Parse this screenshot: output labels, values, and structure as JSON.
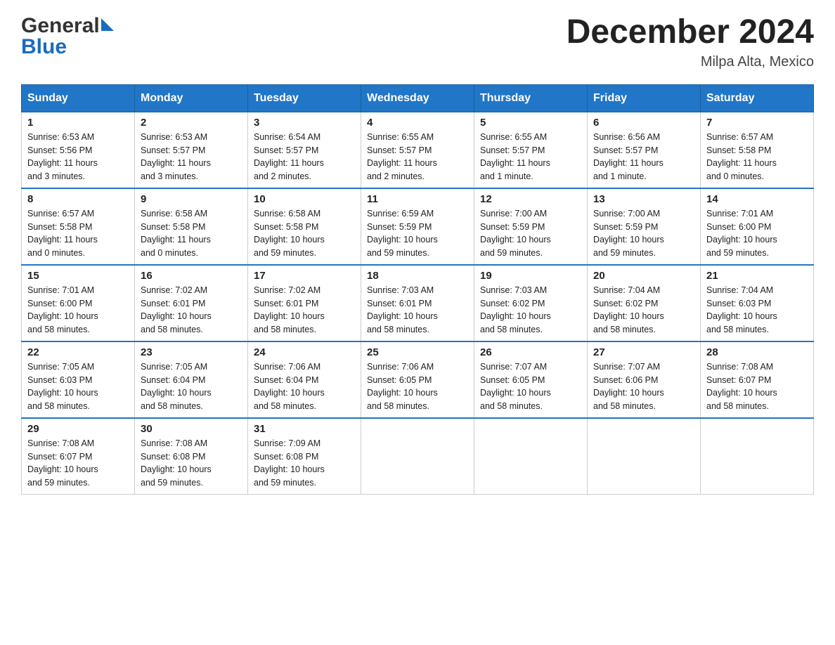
{
  "header": {
    "logo_general": "General",
    "logo_blue": "Blue",
    "month_title": "December 2024",
    "location": "Milpa Alta, Mexico"
  },
  "days_of_week": [
    "Sunday",
    "Monday",
    "Tuesday",
    "Wednesday",
    "Thursday",
    "Friday",
    "Saturday"
  ],
  "weeks": [
    [
      {
        "day": "1",
        "sunrise": "6:53 AM",
        "sunset": "5:56 PM",
        "daylight": "11 hours and 3 minutes."
      },
      {
        "day": "2",
        "sunrise": "6:53 AM",
        "sunset": "5:57 PM",
        "daylight": "11 hours and 3 minutes."
      },
      {
        "day": "3",
        "sunrise": "6:54 AM",
        "sunset": "5:57 PM",
        "daylight": "11 hours and 2 minutes."
      },
      {
        "day": "4",
        "sunrise": "6:55 AM",
        "sunset": "5:57 PM",
        "daylight": "11 hours and 2 minutes."
      },
      {
        "day": "5",
        "sunrise": "6:55 AM",
        "sunset": "5:57 PM",
        "daylight": "11 hours and 1 minute."
      },
      {
        "day": "6",
        "sunrise": "6:56 AM",
        "sunset": "5:57 PM",
        "daylight": "11 hours and 1 minute."
      },
      {
        "day": "7",
        "sunrise": "6:57 AM",
        "sunset": "5:58 PM",
        "daylight": "11 hours and 0 minutes."
      }
    ],
    [
      {
        "day": "8",
        "sunrise": "6:57 AM",
        "sunset": "5:58 PM",
        "daylight": "11 hours and 0 minutes."
      },
      {
        "day": "9",
        "sunrise": "6:58 AM",
        "sunset": "5:58 PM",
        "daylight": "11 hours and 0 minutes."
      },
      {
        "day": "10",
        "sunrise": "6:58 AM",
        "sunset": "5:58 PM",
        "daylight": "10 hours and 59 minutes."
      },
      {
        "day": "11",
        "sunrise": "6:59 AM",
        "sunset": "5:59 PM",
        "daylight": "10 hours and 59 minutes."
      },
      {
        "day": "12",
        "sunrise": "7:00 AM",
        "sunset": "5:59 PM",
        "daylight": "10 hours and 59 minutes."
      },
      {
        "day": "13",
        "sunrise": "7:00 AM",
        "sunset": "5:59 PM",
        "daylight": "10 hours and 59 minutes."
      },
      {
        "day": "14",
        "sunrise": "7:01 AM",
        "sunset": "6:00 PM",
        "daylight": "10 hours and 59 minutes."
      }
    ],
    [
      {
        "day": "15",
        "sunrise": "7:01 AM",
        "sunset": "6:00 PM",
        "daylight": "10 hours and 58 minutes."
      },
      {
        "day": "16",
        "sunrise": "7:02 AM",
        "sunset": "6:01 PM",
        "daylight": "10 hours and 58 minutes."
      },
      {
        "day": "17",
        "sunrise": "7:02 AM",
        "sunset": "6:01 PM",
        "daylight": "10 hours and 58 minutes."
      },
      {
        "day": "18",
        "sunrise": "7:03 AM",
        "sunset": "6:01 PM",
        "daylight": "10 hours and 58 minutes."
      },
      {
        "day": "19",
        "sunrise": "7:03 AM",
        "sunset": "6:02 PM",
        "daylight": "10 hours and 58 minutes."
      },
      {
        "day": "20",
        "sunrise": "7:04 AM",
        "sunset": "6:02 PM",
        "daylight": "10 hours and 58 minutes."
      },
      {
        "day": "21",
        "sunrise": "7:04 AM",
        "sunset": "6:03 PM",
        "daylight": "10 hours and 58 minutes."
      }
    ],
    [
      {
        "day": "22",
        "sunrise": "7:05 AM",
        "sunset": "6:03 PM",
        "daylight": "10 hours and 58 minutes."
      },
      {
        "day": "23",
        "sunrise": "7:05 AM",
        "sunset": "6:04 PM",
        "daylight": "10 hours and 58 minutes."
      },
      {
        "day": "24",
        "sunrise": "7:06 AM",
        "sunset": "6:04 PM",
        "daylight": "10 hours and 58 minutes."
      },
      {
        "day": "25",
        "sunrise": "7:06 AM",
        "sunset": "6:05 PM",
        "daylight": "10 hours and 58 minutes."
      },
      {
        "day": "26",
        "sunrise": "7:07 AM",
        "sunset": "6:05 PM",
        "daylight": "10 hours and 58 minutes."
      },
      {
        "day": "27",
        "sunrise": "7:07 AM",
        "sunset": "6:06 PM",
        "daylight": "10 hours and 58 minutes."
      },
      {
        "day": "28",
        "sunrise": "7:08 AM",
        "sunset": "6:07 PM",
        "daylight": "10 hours and 58 minutes."
      }
    ],
    [
      {
        "day": "29",
        "sunrise": "7:08 AM",
        "sunset": "6:07 PM",
        "daylight": "10 hours and 59 minutes."
      },
      {
        "day": "30",
        "sunrise": "7:08 AM",
        "sunset": "6:08 PM",
        "daylight": "10 hours and 59 minutes."
      },
      {
        "day": "31",
        "sunrise": "7:09 AM",
        "sunset": "6:08 PM",
        "daylight": "10 hours and 59 minutes."
      },
      null,
      null,
      null,
      null
    ]
  ],
  "labels": {
    "sunrise": "Sunrise:",
    "sunset": "Sunset:",
    "daylight": "Daylight:"
  }
}
